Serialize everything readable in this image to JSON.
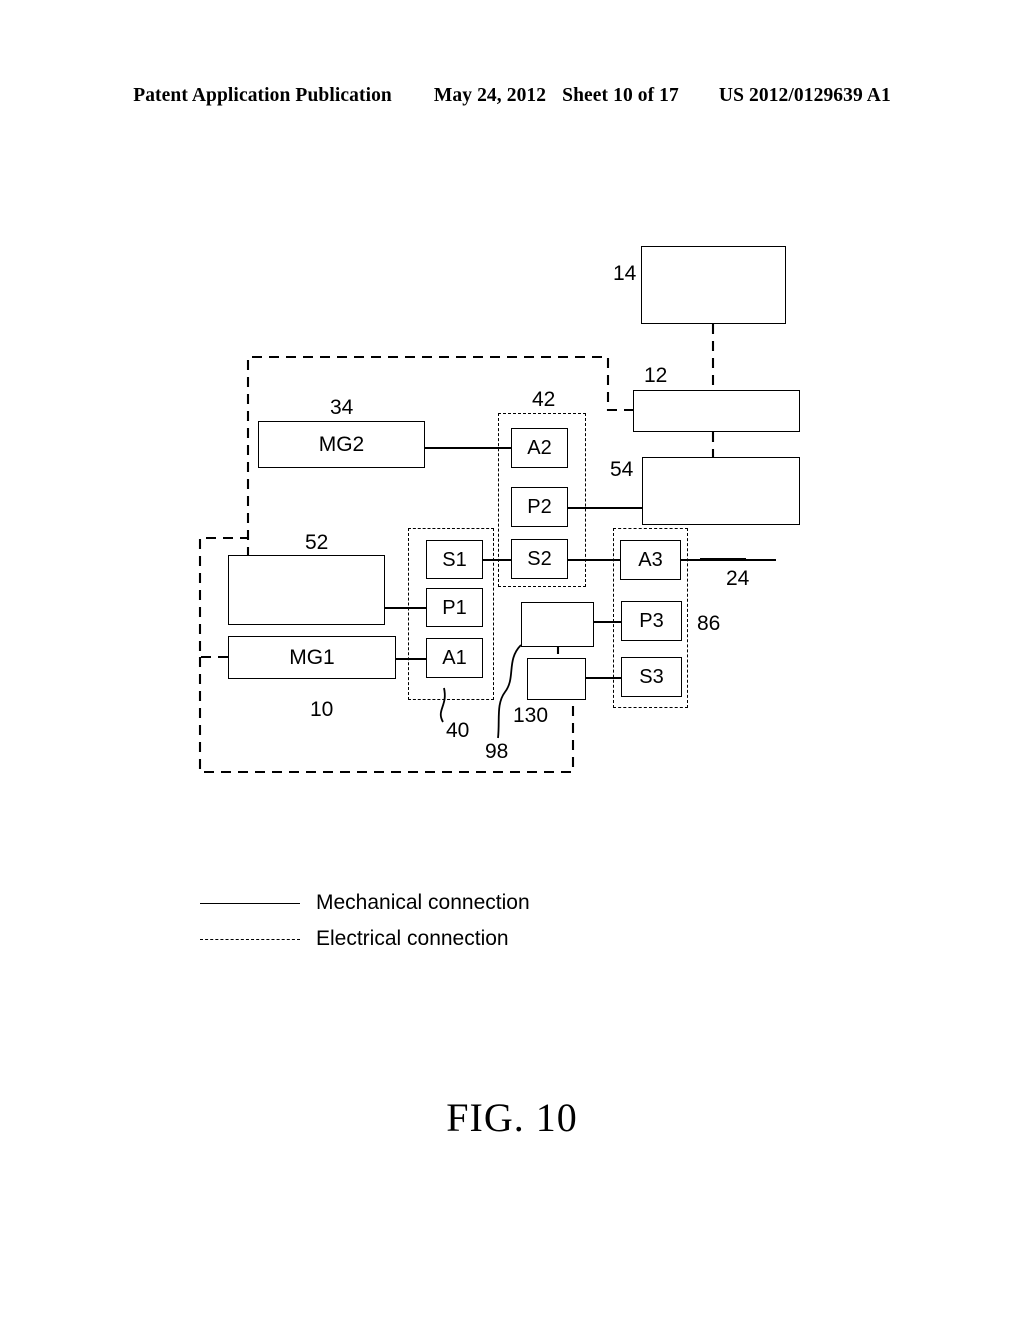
{
  "header": {
    "publication": "Patent Application Publication",
    "date": "May 24, 2012",
    "sheet": "Sheet 10 of 17",
    "document_number": "US 2012/0129639 A1"
  },
  "figure": {
    "caption": "FIG. 10",
    "boxes": {
      "mg2": "MG2",
      "mg1": "MG1",
      "a1": "A1",
      "p1": "P1",
      "s1": "S1",
      "a2": "A2",
      "p2": "P2",
      "s2": "S2",
      "a3": "A3",
      "p3": "P3",
      "s3": "S3",
      "box_14": "",
      "box_12": "",
      "box_54": "",
      "box_52": "",
      "box_130_upper": "",
      "box_130_lower": ""
    },
    "reference_numerals": {
      "n14": "14",
      "n12": "12",
      "n54": "54",
      "n34": "34",
      "n42": "42",
      "n52": "52",
      "n24": "24",
      "n86": "86",
      "n40": "40",
      "n10": "10",
      "n98": "98",
      "n130": "130"
    }
  },
  "legend": {
    "mechanical": "Mechanical connection",
    "electrical": "Electrical connection"
  }
}
